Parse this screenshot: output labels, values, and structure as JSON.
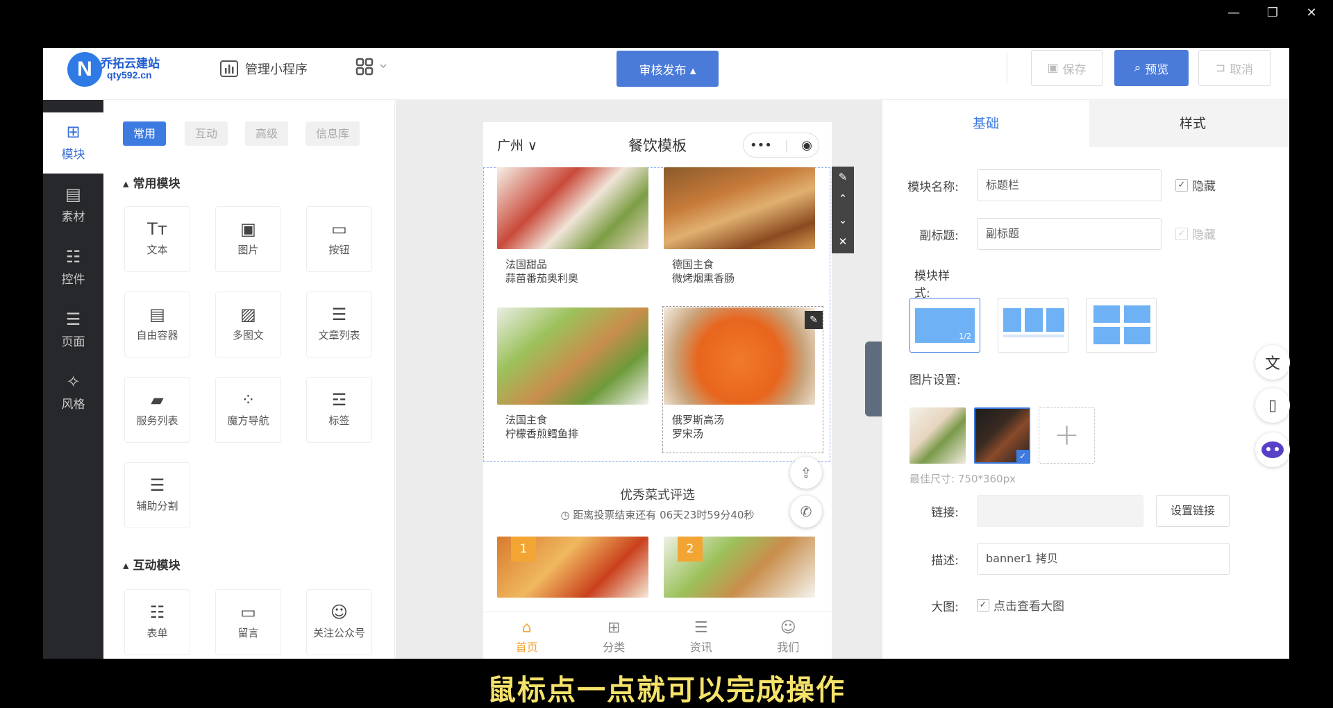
{
  "window": {
    "controls": [
      "—",
      "❐",
      "✕"
    ]
  },
  "topbar": {
    "logo_letter": "N",
    "logo_name": "乔拓云建站",
    "logo_domain": "qty592.cn",
    "manage_label": "管理小程序",
    "publish_label": "审核发布 ▴",
    "save_label": "保存",
    "preview_label": "预览",
    "cancel_label": "取消"
  },
  "sidebar": {
    "items": [
      {
        "label": "模块",
        "icon": "plus-square-icon"
      },
      {
        "label": "素材",
        "icon": "box-icon"
      },
      {
        "label": "控件",
        "icon": "sliders-icon"
      },
      {
        "label": "页面",
        "icon": "page-icon"
      },
      {
        "label": "风格",
        "icon": "magic-wand-icon"
      }
    ]
  },
  "palette": {
    "tabs": [
      "常用",
      "互动",
      "高级",
      "信息库"
    ],
    "section_common": "常用模块",
    "section_interact": "互动模块",
    "common_modules": [
      "文本",
      "图片",
      "按钮",
      "自由容器",
      "多图文",
      "文章列表",
      "服务列表",
      "魔方导航",
      "标签",
      "辅助分割"
    ],
    "interact_modules": [
      "表单",
      "留言",
      "关注公众号"
    ]
  },
  "phone": {
    "city": "广州 ∨",
    "title": "餐饮模板",
    "capsule_dots": "•••",
    "capsule_target": "◉",
    "cards": [
      {
        "line1": "法国甜品",
        "line2": "蒜苗番茄奥利奥"
      },
      {
        "line1": "德国主食",
        "line2": "微烤烟熏香肠"
      },
      {
        "line1": "法国主食",
        "line2": "柠檬香煎鳕鱼排"
      },
      {
        "line1": "俄罗斯高汤",
        "line2": "罗宋汤"
      }
    ],
    "vote_title": "优秀菜式评选",
    "vote_sub": "◷ 距离投票结束还有 06天23时59分40秒",
    "rank_badges": [
      "1",
      "2"
    ],
    "tabbar": [
      "首页",
      "分类",
      "资讯",
      "我们"
    ]
  },
  "props": {
    "tab_basic": "基础",
    "tab_style": "样式",
    "name_label": "模块名称:",
    "name_value": "标题栏",
    "subtitle_label": "副标题:",
    "subtitle_value": "副标题",
    "hide_label": "隐藏",
    "style_label": "模块样式:",
    "style_badge": "1/2",
    "image_label": "图片设置:",
    "best_size": "最佳尺寸: 750*360px",
    "link_label": "链接:",
    "link_btn": "设置链接",
    "desc_label": "描述:",
    "desc_value": "banner1 拷贝",
    "big_label": "大图:",
    "big_check": "点击查看大图"
  },
  "subtitle_caption": "鼠标点一点就可以完成操作",
  "colors": {
    "accent": "#4b7bd9",
    "sidebar": "#27282c",
    "highlight": "#f3a534",
    "caption": "#f5e26a"
  }
}
